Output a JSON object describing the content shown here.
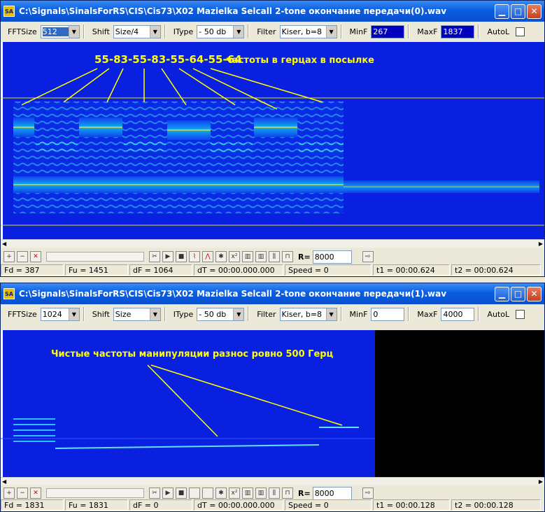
{
  "windows": [
    {
      "title": "C:\\Signals\\SinalsForRS\\CIS\\Cis73\\X02 Mazielka Selcall 2-tone окончание передачи(0).wav",
      "app_icon": "SA",
      "toolbar": {
        "fftsize_label": "FFTSize",
        "fftsize_value": "512",
        "shift_label": "Shift",
        "shift_value": "Size/4",
        "itype_label": "IType",
        "itype_value": "- 50 db",
        "filter_label": "Filter",
        "filter_value": "Kiser, b=8",
        "minf_label": "MinF",
        "minf_value": "267",
        "maxf_label": "MaxF",
        "maxf_value": "1837",
        "autol_label": "AutoL"
      },
      "annotation_digits": "55-83-55-83-55-64-55-64",
      "annotation_text": "частоты в герцах в посылке",
      "rate_label": "R=",
      "rate_value": "8000",
      "status": {
        "fd": "Fd = 387",
        "fu": "Fu = 1451",
        "df": "dF = 1064",
        "dt": "dT = 00:00.000.000",
        "speed": "Speed = 0",
        "t1": "t1 = 00:00.624",
        "t2": "t2 = 00:00.624"
      }
    },
    {
      "title": "C:\\Signals\\SinalsForRS\\CIS\\Cis73\\X02 Mazielka Selcall 2-tone окончание передачи(1).wav",
      "app_icon": "SA",
      "toolbar": {
        "fftsize_label": "FFTSize",
        "fftsize_value": "1024",
        "shift_label": "Shift",
        "shift_value": "Size",
        "itype_label": "IType",
        "itype_value": "- 50 db",
        "filter_label": "Filter",
        "filter_value": "Kiser, b=8",
        "minf_label": "MinF",
        "minf_value": "0",
        "maxf_label": "MaxF",
        "maxf_value": "4000",
        "autol_label": "AutoL"
      },
      "annotation_text": "Чистые частоты манипуляции   разнос ровно 500 Герц",
      "rate_label": "R=",
      "rate_value": "8000",
      "status": {
        "fd": "Fd = 1831",
        "fu": "Fu = 1831",
        "df": "dF = 0",
        "dt": "dT = 00:00.000.000",
        "speed": "Speed = 0",
        "t1": "t1 = 00:00.128",
        "t2": "t2 = 00:00.128"
      }
    }
  ],
  "colors": {
    "spectrogram_bg": "#0a20e0",
    "annotation": "#ffff00",
    "titlebar": "#0a5ee0"
  },
  "icons": [
    "zoom-in-icon",
    "zoom-out-icon",
    "reset-zoom-icon",
    "cut-icon",
    "play-icon",
    "stop-icon",
    "chart-icon",
    "marker-icon",
    "export-icon"
  ]
}
